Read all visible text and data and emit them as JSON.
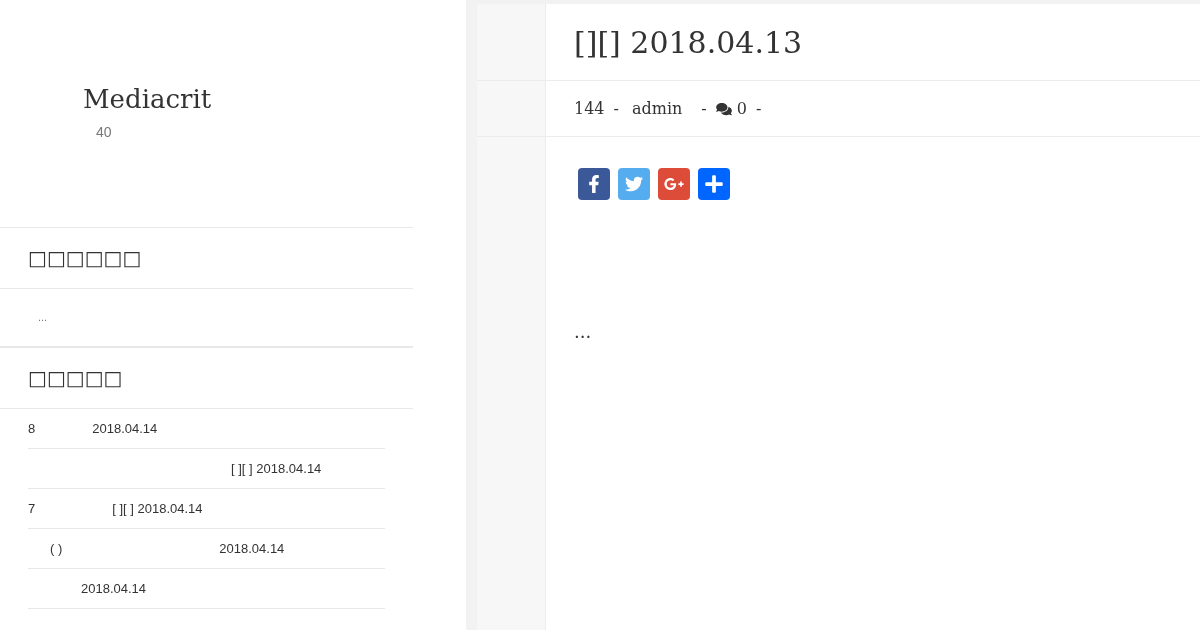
{
  "site": {
    "title": "Mediacrit",
    "subtitle": "40"
  },
  "widgets": [
    {
      "title": "□□□□□□",
      "items": [
        {
          "texts": [
            "..."
          ]
        }
      ]
    },
    {
      "title": "□□□□□",
      "items": [
        {
          "texts": [
            "8",
            "2018.04.14"
          ]
        },
        {
          "texts": [
            "[ ][ ] 2018.04.14"
          ]
        },
        {
          "texts": [
            "7",
            "[ ][ ] 2018.04.14"
          ]
        },
        {
          "texts": [
            "( )",
            "2018.04.14"
          ]
        },
        {
          "texts": [
            "2018.04.14"
          ]
        }
      ]
    }
  ],
  "post": {
    "title": "[][] 2018.04.13",
    "meta": [
      {
        "kind": "text",
        "text": "144"
      },
      {
        "kind": "sep",
        "text": "-"
      },
      {
        "kind": "text",
        "text": "admin"
      },
      {
        "kind": "sep",
        "text": "-"
      },
      {
        "kind": "comments",
        "text": "0"
      },
      {
        "kind": "sep",
        "text": "-"
      }
    ],
    "share": [
      {
        "kind": "facebook"
      },
      {
        "kind": "twitter"
      },
      {
        "kind": "google"
      },
      {
        "kind": "share"
      }
    ],
    "excerpt": "..."
  }
}
